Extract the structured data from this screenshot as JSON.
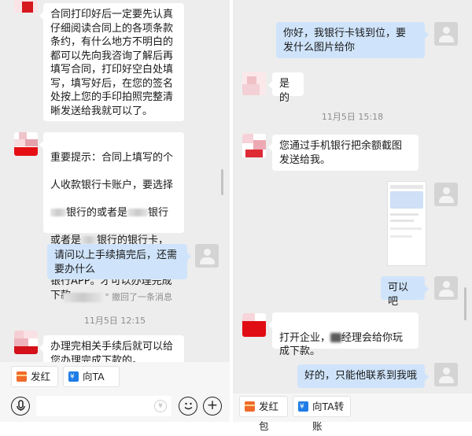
{
  "left": {
    "messages": [
      {
        "text": "合同打印好后一定要先认真\n仔细阅读合同上的各项条款\n条约，有什么地方不明白的\n都可以先向我咨询了解后再\n填写合同，打印好空白处填\n写，填写好后，在您的签名\n处按上您的手印拍照完整清\n晰发送给我就可以了。"
      },
      {
        "line1": "重要提示：合同上填写的个",
        "line2": "人收款银行卡账户，要选择",
        "line3": "银行的或者是",
        "line3b": "银行",
        "line4a": "或者是",
        "line4b": "银行的银行卡，",
        "rest": "并且要有使用该银行的手机\n银行APP。才可以办理完成\n下款。"
      },
      {
        "text": "请问以上手续搞完后，还需\n要办什么"
      },
      {
        "text": "办理完相关手续后就可以给\n您办理完成下款的。"
      }
    ],
    "recall_notice": "\" 撤回了一条消息",
    "timestamp": "11月5日 12:15",
    "toolbar": {
      "red_packet": "发红包",
      "transfer": "向TA转账"
    }
  },
  "right": {
    "messages": [
      {
        "text": "你好，我银行卡钱到位，要\n发什么图片给你"
      },
      {
        "text": "是的"
      },
      {
        "text": "您通过手机银行把余额截图\n发送给我。"
      },
      {
        "text": "可以吧"
      },
      {
        "part1": "打开企业，",
        "part2": "经理会给你玩\n成下款。"
      },
      {
        "text": "好的，只能他联系到我哦"
      }
    ],
    "timestamp": "11月5日 15:18",
    "toolbar": {
      "red_packet": "发红包",
      "transfer": "向TA转账"
    }
  },
  "colors": {
    "incoming": "#ffffff",
    "outgoing": "#cfe4fb",
    "background": "#ededed"
  },
  "icons": [
    "voice-icon",
    "emoji-icon",
    "plus-icon",
    "yen-icon",
    "red-packet-icon",
    "transfer-icon"
  ]
}
